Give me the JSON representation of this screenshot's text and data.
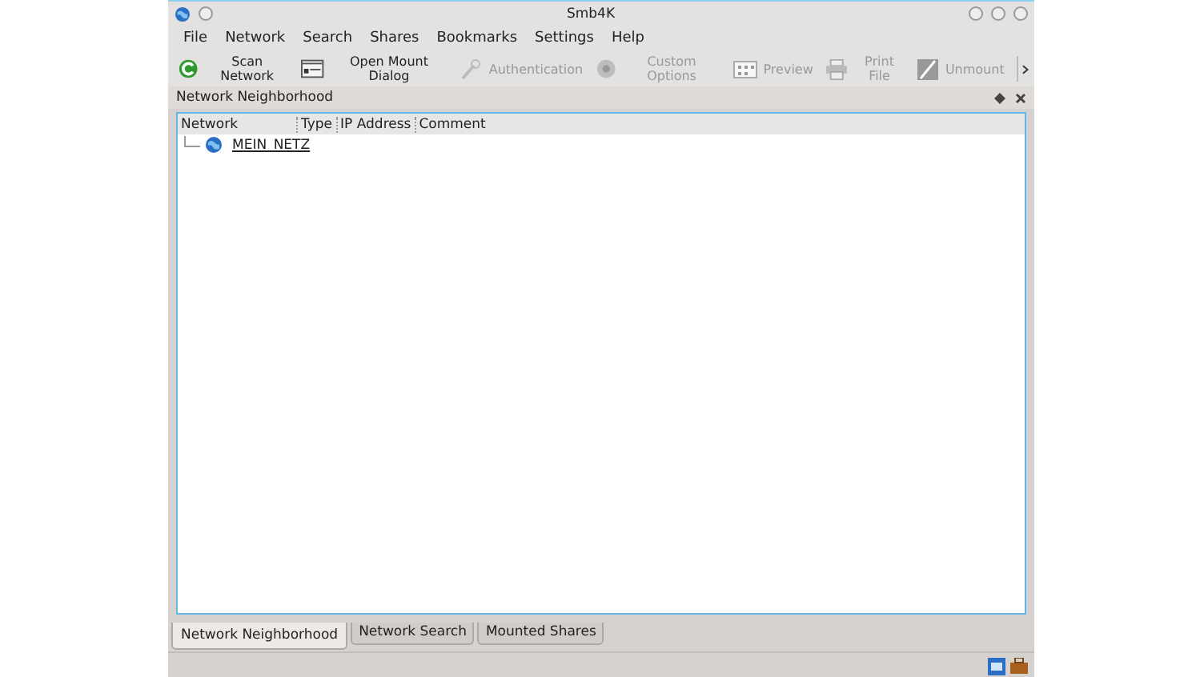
{
  "window": {
    "title": "Smb4K"
  },
  "menu": [
    "File",
    "Network",
    "Search",
    "Shares",
    "Bookmarks",
    "Settings",
    "Help"
  ],
  "toolbar": [
    {
      "label": "Scan Network",
      "kind": "scan",
      "disabled": false
    },
    {
      "label": "Open Mount Dialog",
      "kind": "mount",
      "disabled": false
    },
    {
      "label": "Authentication",
      "kind": "key",
      "disabled": true
    },
    {
      "label": "Custom Options",
      "kind": "options",
      "disabled": true
    },
    {
      "label": "Preview",
      "kind": "preview",
      "disabled": true
    },
    {
      "label": "Print File",
      "kind": "print",
      "disabled": true
    },
    {
      "label": "Unmount",
      "kind": "unmount",
      "disabled": true
    }
  ],
  "dock": {
    "title": "Network Neighborhood"
  },
  "tree": {
    "columns": [
      "Network",
      "Type",
      "IP Address",
      "Comment"
    ],
    "items": [
      {
        "name": "MEIN_NETZ",
        "expanded": false
      }
    ]
  },
  "tabs": [
    {
      "label": "Network Neighborhood",
      "selected": true
    },
    {
      "label": "Network Search",
      "selected": false
    },
    {
      "label": "Mounted Shares",
      "selected": false
    }
  ]
}
